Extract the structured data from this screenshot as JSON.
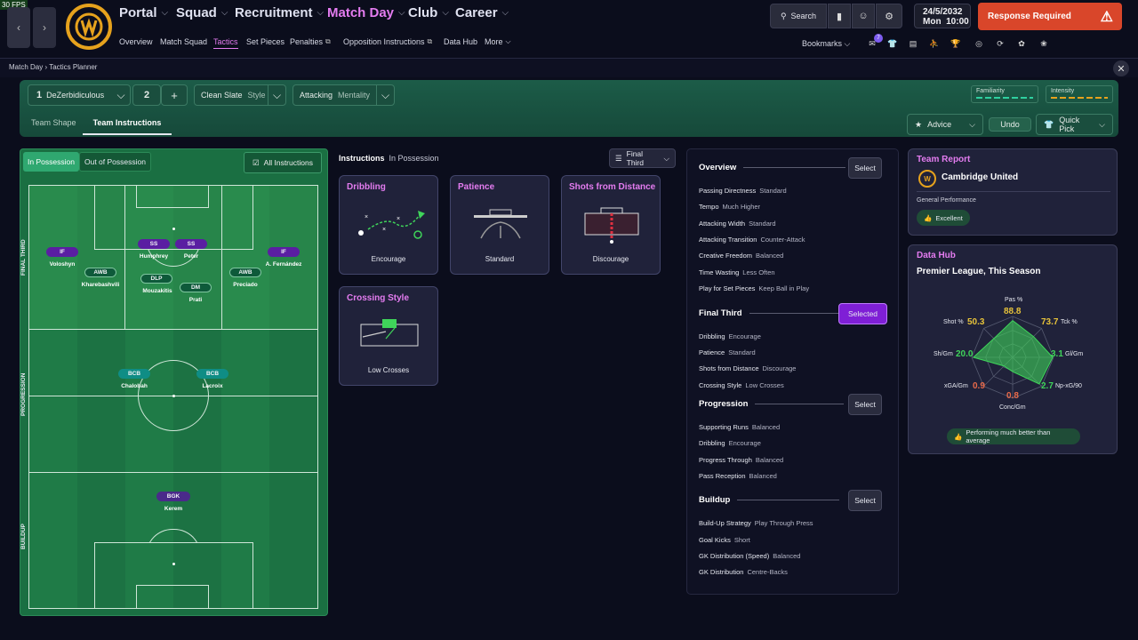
{
  "fps": "30 FPS",
  "nav": {
    "menus": [
      {
        "label": "Portal",
        "active": false
      },
      {
        "label": "Squad",
        "active": false
      },
      {
        "label": "Recruitment",
        "active": false
      },
      {
        "label": "Match Day",
        "active": true
      },
      {
        "label": "Club",
        "active": false
      },
      {
        "label": "Career",
        "active": false
      }
    ],
    "submenus": [
      "Overview",
      "Match Squad",
      "Tactics",
      "Set Pieces",
      "Penalties",
      "Opposition Instructions",
      "Data Hub",
      "More"
    ],
    "search": "Search",
    "date": "24/5/2032",
    "day": "Mon",
    "time": "10:00",
    "response": "Response Required",
    "bookmarks": "Bookmarks",
    "bookmark_badge": "7"
  },
  "breadcrumb": {
    "parent": "Match Day",
    "current": "Tactics Planner"
  },
  "tactic": {
    "slot": "1",
    "name": "DeZerbidiculous",
    "slot2": "2",
    "plus": "+",
    "clean": "Clean Slate",
    "style": "Style",
    "attacking": "Attacking",
    "mentality": "Mentality",
    "familiarity": "Familiarity",
    "intensity": "Intensity"
  },
  "tabs": {
    "shape": "Team Shape",
    "instructions": "Team Instructions",
    "advice": "Advice",
    "undo": "Undo",
    "quickpick": "Quick Pick"
  },
  "pitch": {
    "in_poss": "In Possession",
    "out_poss": "Out of Possession",
    "all_inst": "All Instructions",
    "zones": [
      "FINAL THIRD",
      "PROGRESSION",
      "BUILDUP"
    ],
    "players": [
      {
        "role": "IF",
        "name": "Voloshyn",
        "cls": "fw"
      },
      {
        "role": "SS",
        "name": "Humphrey",
        "cls": "fw"
      },
      {
        "role": "SS",
        "name": "Peter",
        "cls": "fw"
      },
      {
        "role": "IF",
        "name": "A. Fernández",
        "cls": "fw"
      },
      {
        "role": "AWB",
        "name": "Kharebashvili",
        "cls": "mf"
      },
      {
        "role": "DLP",
        "name": "Mouzakitis",
        "cls": "mf"
      },
      {
        "role": "DM",
        "name": "Prati",
        "cls": "mf"
      },
      {
        "role": "AWB",
        "name": "Preciado",
        "cls": "mf"
      },
      {
        "role": "BCB",
        "name": "Chalobah",
        "cls": "df"
      },
      {
        "role": "BCB",
        "name": "Lacroix",
        "cls": "df"
      },
      {
        "role": "BGK",
        "name": "Kerem",
        "cls": "gk"
      }
    ]
  },
  "instructions": {
    "title": "Instructions",
    "context": "In Possession",
    "filter": "Final Third",
    "cards": [
      {
        "title": "Dribbling",
        "value": "Encourage"
      },
      {
        "title": "Patience",
        "value": "Standard"
      },
      {
        "title": "Shots from Distance",
        "value": "Discourage"
      },
      {
        "title": "Crossing Style",
        "value": "Low Crosses"
      }
    ]
  },
  "overview": {
    "sections": [
      {
        "title": "Overview",
        "button": "Select",
        "rows": [
          [
            "Passing Directness",
            "Standard"
          ],
          [
            "Tempo",
            "Much Higher"
          ],
          [
            "Attacking Width",
            "Standard"
          ],
          [
            "Attacking Transition",
            "Counter-Attack"
          ],
          [
            "Creative Freedom",
            "Balanced"
          ],
          [
            "Time Wasting",
            "Less Often"
          ],
          [
            "Play for Set Pieces",
            "Keep Ball in Play"
          ]
        ]
      },
      {
        "title": "Final Third",
        "button": "Selected",
        "rows": [
          [
            "Dribbling",
            "Encourage"
          ],
          [
            "Patience",
            "Standard"
          ],
          [
            "Shots from Distance",
            "Discourage"
          ],
          [
            "Crossing Style",
            "Low Crosses"
          ]
        ]
      },
      {
        "title": "Progression",
        "button": "Select",
        "rows": [
          [
            "Supporting Runs",
            "Balanced"
          ],
          [
            "Dribbling",
            "Encourage"
          ],
          [
            "Progress Through",
            "Balanced"
          ],
          [
            "Pass Reception",
            "Balanced"
          ]
        ]
      },
      {
        "title": "Buildup",
        "button": "Select",
        "rows": [
          [
            "Build-Up Strategy",
            "Play Through Press"
          ],
          [
            "Goal Kicks",
            "Short"
          ],
          [
            "GK Distribution (Speed)",
            "Balanced"
          ],
          [
            "GK Distribution",
            "Centre-Backs"
          ]
        ]
      }
    ]
  },
  "report": {
    "title": "Team Report",
    "club": "Cambridge United",
    "perf_label": "General Performance",
    "perf": "Excellent"
  },
  "datahub": {
    "title": "Data Hub",
    "subtitle": "Premier League, This Season",
    "footer": "Performing much better than average",
    "stats": [
      {
        "label": "Pas %",
        "value": "88.8",
        "color": "#e6c23a",
        "level": 0.9
      },
      {
        "label": "Tck %",
        "value": "73.7",
        "color": "#e6c23a",
        "level": 0.72
      },
      {
        "label": "Gl/Gm",
        "value": "3.1",
        "color": "#3fd45a",
        "level": 0.98
      },
      {
        "label": "Np-xG/90",
        "value": "2.7",
        "color": "#3fd45a",
        "level": 0.92
      },
      {
        "label": "Conc/Gm",
        "value": "0.8",
        "color": "#e86a4a",
        "level": 0.35
      },
      {
        "label": "xGA/Gm",
        "value": "0.9",
        "color": "#e86a4a",
        "level": 0.3
      },
      {
        "label": "Sh/Gm",
        "value": "20.0",
        "color": "#3fd45a",
        "level": 0.96
      },
      {
        "label": "Shot %",
        "value": "50.3",
        "color": "#e6c23a",
        "level": 0.65
      }
    ]
  }
}
